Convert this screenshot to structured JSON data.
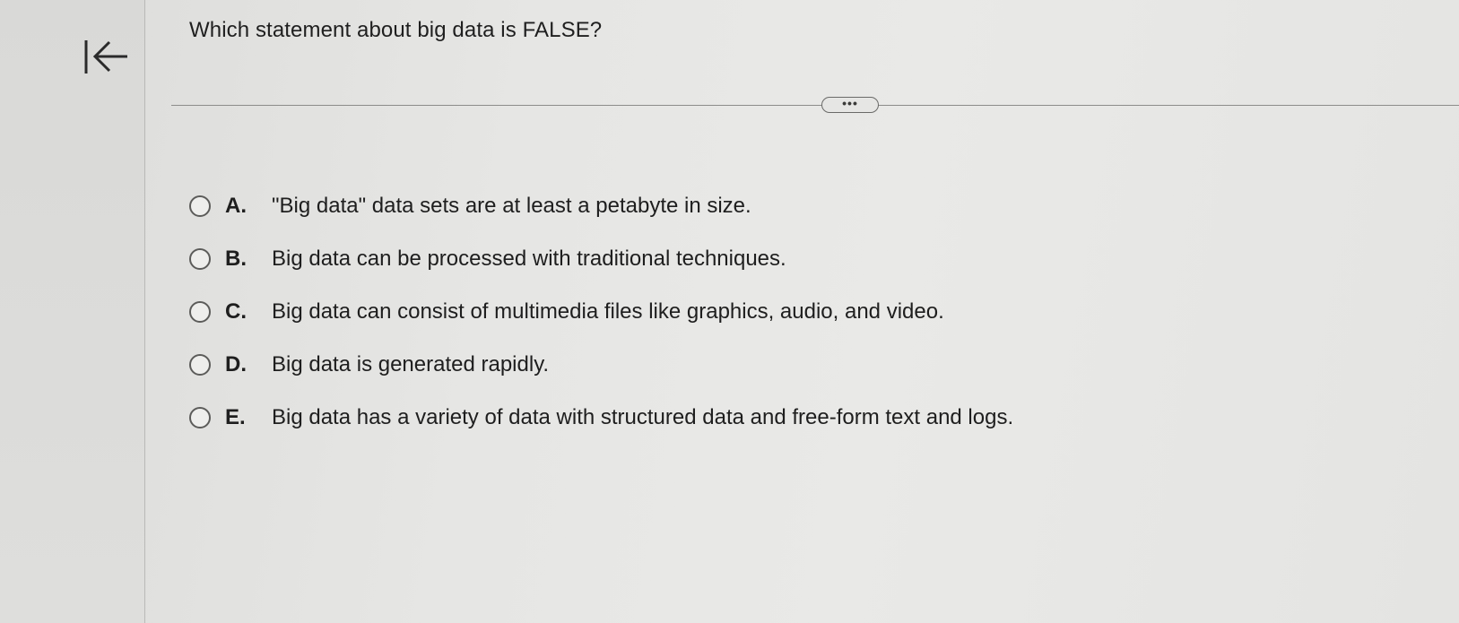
{
  "question": {
    "text": "Which statement about big data is FALSE?"
  },
  "icons": {
    "back": "arrow-left-to-bar-icon",
    "more": "ellipsis-icon"
  },
  "more_button": {
    "label": "•••"
  },
  "options": [
    {
      "letter": "A.",
      "text": "\"Big data\" data sets are at least a petabyte in size."
    },
    {
      "letter": "B.",
      "text": "Big data can be processed with traditional techniques."
    },
    {
      "letter": "C.",
      "text": "Big data can consist of multimedia files like graphics, audio, and video."
    },
    {
      "letter": "D.",
      "text": "Big data is generated rapidly."
    },
    {
      "letter": "E.",
      "text": "Big data has a variety of data with structured data and free-form text and logs."
    }
  ],
  "colors": {
    "background": "#e6e6e4",
    "panel": "#dcdcda",
    "text": "#1e1e1e",
    "divider": "#8c8c8a"
  }
}
